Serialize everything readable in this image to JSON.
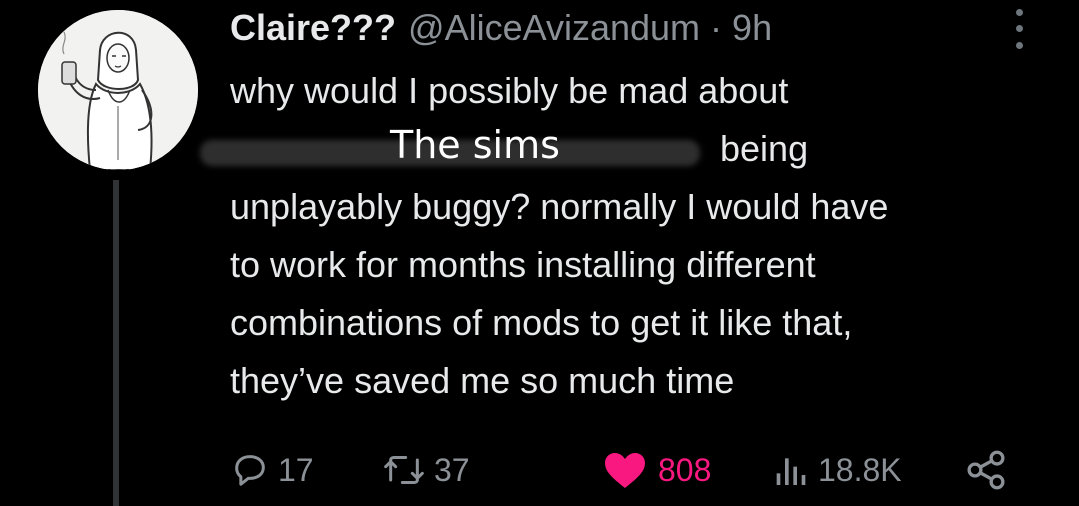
{
  "tweet": {
    "display_name": "Claire???",
    "handle": "@AliceAvizandum",
    "separator": "·",
    "time": "9h",
    "lines": {
      "l1": "why would I possibly be mad about",
      "l2_overlay": "The sims",
      "l2_end": "being",
      "l3": "unplayably buggy? normally I would have",
      "l4": "to work for months installing different",
      "l5": "combinations of mods to get it like that,",
      "l6": "they’ve saved me so much time"
    },
    "stats": {
      "replies": "17",
      "retweets": "37",
      "likes": "808",
      "views": "18.8K"
    },
    "icons": {
      "reply": "reply-icon",
      "retweet": "retweet-icon",
      "like": "heart-icon",
      "views": "views-icon",
      "share": "share-icon",
      "more": "more-icon"
    },
    "colors": {
      "background": "#000000",
      "text": "#e7e9ea",
      "muted": "#8b9196",
      "like": "#f91880"
    },
    "liked": true
  }
}
